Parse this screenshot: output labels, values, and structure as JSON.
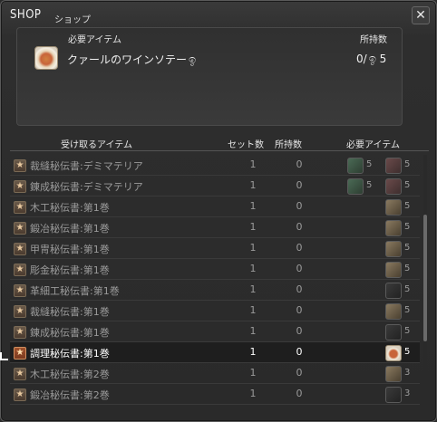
{
  "window": {
    "title_en": "SHOP",
    "title_jp": "ショップ"
  },
  "required": {
    "header_item": "必要アイテム",
    "header_owned": "所持数",
    "item_name": "クァールのワインソテー",
    "owned": "0",
    "needed": "5"
  },
  "list": {
    "headers": {
      "receive": "受け取るアイテム",
      "set_count": "セット数",
      "owned": "所持数",
      "required": "必要アイテム"
    },
    "rows": [
      {
        "name": "裁縫秘伝書:デミマテリア",
        "set": "1",
        "owned": "0",
        "mats": [
          {
            "icon": "green-materia-icon",
            "qty": "5"
          },
          {
            "icon": "red-materia-icon",
            "qty": "5"
          }
        ]
      },
      {
        "name": "錬成秘伝書:デミマテリア",
        "set": "1",
        "owned": "0",
        "mats": [
          {
            "icon": "green-materia-icon",
            "qty": "5"
          },
          {
            "icon": "red-materia-icon",
            "qty": "5"
          }
        ]
      },
      {
        "name": "木工秘伝書:第1巻",
        "set": "1",
        "owned": "0",
        "mats": [
          {
            "icon": "lumber-icon",
            "qty": "5"
          }
        ]
      },
      {
        "name": "鍛冶秘伝書:第1巻",
        "set": "1",
        "owned": "0",
        "mats": [
          {
            "icon": "lumber-icon",
            "qty": "5"
          }
        ]
      },
      {
        "name": "甲冑秘伝書:第1巻",
        "set": "1",
        "owned": "0",
        "mats": [
          {
            "icon": "lumber-icon",
            "qty": "5"
          }
        ]
      },
      {
        "name": "彫金秘伝書:第1巻",
        "set": "1",
        "owned": "0",
        "mats": [
          {
            "icon": "lumber-icon",
            "qty": "5"
          }
        ]
      },
      {
        "name": "革細工秘伝書:第1巻",
        "set": "1",
        "owned": "0",
        "mats": [
          {
            "icon": "ingot-icon",
            "qty": "5"
          }
        ]
      },
      {
        "name": "裁縫秘伝書:第1巻",
        "set": "1",
        "owned": "0",
        "mats": [
          {
            "icon": "cloth-icon",
            "qty": "5"
          }
        ]
      },
      {
        "name": "錬成秘伝書:第1巻",
        "set": "1",
        "owned": "0",
        "mats": [
          {
            "icon": "ingot-icon",
            "qty": "5"
          }
        ]
      },
      {
        "name": "調理秘伝書:第1巻",
        "set": "1",
        "owned": "0",
        "selected": true,
        "mats": [
          {
            "icon": "dish-icon",
            "qty": "5"
          }
        ]
      },
      {
        "name": "木工秘伝書:第2巻",
        "set": "1",
        "owned": "0",
        "mats": [
          {
            "icon": "lumber-icon",
            "qty": "3"
          }
        ]
      },
      {
        "name": "鍛冶秘伝書:第2巻",
        "set": "1",
        "owned": "0",
        "mats": [
          {
            "icon": "ingot-icon",
            "qty": "3"
          }
        ]
      }
    ]
  }
}
